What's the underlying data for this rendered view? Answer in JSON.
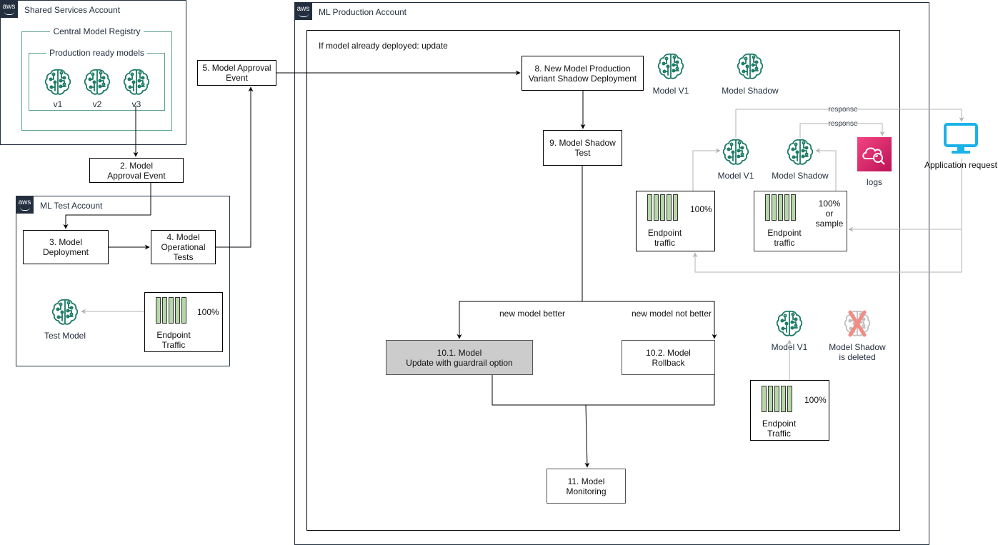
{
  "accounts": {
    "shared": {
      "title": "Shared Services Account",
      "badge": "aws"
    },
    "test": {
      "title": "ML Test Account",
      "badge": "aws"
    },
    "prod": {
      "title": "ML Production Account",
      "badge": "aws"
    }
  },
  "registry": {
    "title": "Central Model Registry",
    "subgroup_title": "Production ready models",
    "models": [
      "v1",
      "v2",
      "v3"
    ]
  },
  "steps": {
    "s2": "2. Model\nApproval Event",
    "s3": "3. Model\nDeployment",
    "s4": "4. Model\nOperational\nTests",
    "s5": "5. Model Approval\nEvent",
    "s8": "8. New Model Production\nVariant Shadow Deployment",
    "s9": "9. Model Shadow\nTest",
    "s10_1": "10.1. Model\nUpdate with guardrail option",
    "s10_2": "10.2. Model\nRollback",
    "s11": "11. Model\nMonitoring"
  },
  "test_env": {
    "model_label": "Test Model",
    "traffic_label": "Endpoint\nTraffic",
    "traffic_pct": "100%"
  },
  "prod_env": {
    "condition_note": "If model already deployed: update",
    "legend_model_v1": "Model V1",
    "legend_model_shadow": "Model Shadow",
    "shadow": {
      "response_1": "response",
      "response_2": "response",
      "model_v1": "Model V1",
      "model_shadow": "Model Shadow",
      "logs": "logs",
      "app_request": "Application request",
      "traffic_v1_label": "Endpoint\ntraffic",
      "traffic_v1_pct": "100%",
      "traffic_shadow_label": "Endpoint\ntraffic",
      "traffic_shadow_pct": "100%\nor sample"
    },
    "branch_better": "new model better",
    "branch_not_better": "new model not better",
    "rollback": {
      "model_v1": "Model V1",
      "shadow_deleted": "Model Shadow\nis deleted",
      "traffic_label": "Endpoint\nTraffic",
      "traffic_pct": "100%"
    }
  },
  "colors": {
    "aws_dark": "#232f3e",
    "model_green": "#1b7a65",
    "traffic_green": "#b6d7a8",
    "logs_pink": "#e7157b",
    "app_blue": "#1ab2e8",
    "grey_box": "#cccccc",
    "delete_red": "#f28b82"
  }
}
